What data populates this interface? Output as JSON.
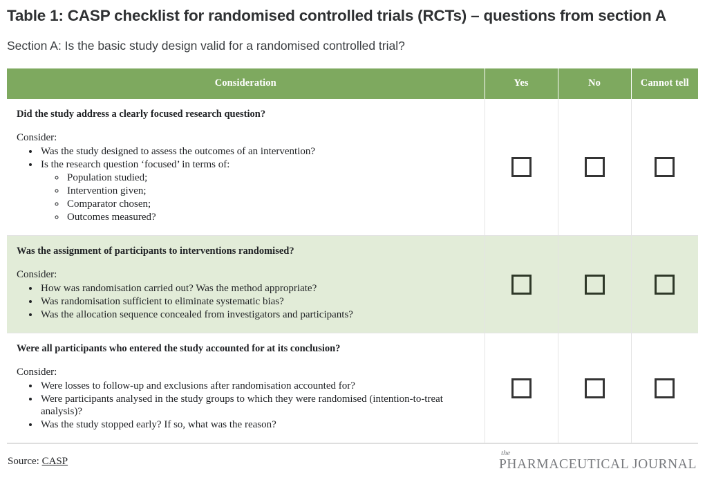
{
  "heading": {
    "title": "Table 1: CASP checklist for randomised controlled trials (RCTs) – questions from section A",
    "subtitle": "Section A: Is the basic study design valid for a randomised controlled trial?"
  },
  "table": {
    "columns": [
      {
        "key": "consideration",
        "label": "Consideration"
      },
      {
        "key": "yes",
        "label": "Yes"
      },
      {
        "key": "no",
        "label": "No"
      },
      {
        "key": "cannot_tell",
        "label": "Cannot tell"
      }
    ],
    "consider_label": "Consider:",
    "rows": [
      {
        "shaded": false,
        "question": "Did the study address a clearly focused research question?",
        "bullets": [
          {
            "text": "Was the study designed to assess the outcomes of an intervention?",
            "sub": []
          },
          {
            "text": "Is the research question ‘focused’ in terms of:",
            "sub": [
              "Population studied;",
              "Intervention given;",
              "Comparator chosen;",
              "Outcomes measured?"
            ]
          }
        ],
        "yes_checked": false,
        "no_checked": false,
        "cannot_tell_checked": false
      },
      {
        "shaded": true,
        "question": "Was the assignment of participants to interventions randomised?",
        "bullets": [
          {
            "text": "How was randomisation carried out? Was the method appropriate?",
            "sub": []
          },
          {
            "text": "Was randomisation sufficient to eliminate systematic bias?",
            "sub": []
          },
          {
            "text": "Was the allocation sequence concealed from investigators and participants?",
            "sub": []
          }
        ],
        "yes_checked": false,
        "no_checked": false,
        "cannot_tell_checked": false
      },
      {
        "shaded": false,
        "question": "Were all participants who entered the study accounted for at its conclusion?",
        "bullets": [
          {
            "text": "Were losses to follow-up and exclusions after randomisation accounted for?",
            "sub": []
          },
          {
            "text": "Were participants analysed in the study groups to which they were randomised (intention-to-treat analysis)?",
            "sub": []
          },
          {
            "text": "Was the study stopped early? If so, what was the reason?",
            "sub": []
          }
        ],
        "yes_checked": false,
        "no_checked": false,
        "cannot_tell_checked": false
      }
    ]
  },
  "footer": {
    "source_label": "Source:",
    "source_link": "CASP",
    "logo_the": "the",
    "logo_name": "PHARMACEUTICAL JOURNAL"
  },
  "colors": {
    "header_green": "#7ea95f",
    "row_shade_green": "#e2ecd8",
    "text_dark": "#2f3133",
    "checkbox_border": "#343434",
    "divider": "#e4e4e4",
    "logo_grey": "#77797d"
  }
}
